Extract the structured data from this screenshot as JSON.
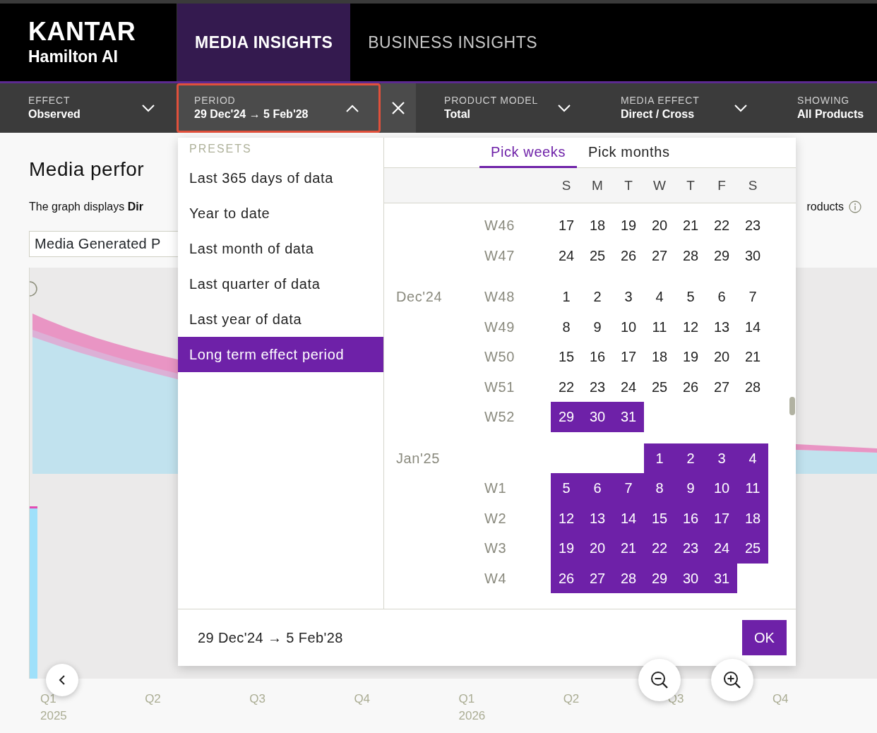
{
  "header": {
    "logo": {
      "brand": "KANTAR",
      "product": "Hamilton AI"
    },
    "tabs": [
      {
        "label": "MEDIA INSIGHTS",
        "selected": true
      },
      {
        "label": "BUSINESS INSIGHTS",
        "selected": false
      }
    ]
  },
  "filters": [
    {
      "kind": "dropdown",
      "label": "EFFECT",
      "value": "Observed",
      "expanded": false,
      "highlighted": false
    },
    {
      "kind": "dropdown",
      "label": "PERIOD",
      "value": "29 Dec'24 → 5 Feb'28",
      "expanded": true,
      "highlighted": true
    },
    {
      "kind": "clear"
    },
    {
      "kind": "dropdown",
      "label": "PRODUCT MODEL",
      "value": "Total",
      "expanded": false,
      "highlighted": false
    },
    {
      "kind": "dropdown",
      "label": "MEDIA EFFECT",
      "value": "Direct / Cross",
      "expanded": false,
      "highlighted": false
    },
    {
      "kind": "text",
      "label": "SHOWING",
      "value": "All Products"
    }
  ],
  "content": {
    "title": "Media perfor",
    "description": "The graph displays **Dir**",
    "description_end": "roducts",
    "metric_select": "Media Generated P",
    "x_axis": [
      {
        "quarter": "Q1",
        "year": "2025"
      },
      {
        "quarter": "Q2"
      },
      {
        "quarter": "Q3"
      },
      {
        "quarter": "Q4"
      },
      {
        "quarter": "Q1",
        "year": "2026"
      },
      {
        "quarter": "Q2"
      },
      {
        "quarter": "Q3"
      },
      {
        "quarter": "Q4"
      }
    ]
  },
  "period_panel": {
    "presets_heading": "PRESETS",
    "presets": [
      {
        "label": "Last 365 days of data",
        "selected": false
      },
      {
        "label": "Year to date",
        "selected": false
      },
      {
        "label": "Last month of data",
        "selected": false
      },
      {
        "label": "Last quarter of data",
        "selected": false
      },
      {
        "label": "Last year of data",
        "selected": false
      },
      {
        "label": "Long term effect period",
        "selected": true
      }
    ],
    "modes": [
      {
        "label": "Pick weeks",
        "selected": true
      },
      {
        "label": "Pick months",
        "selected": false
      }
    ],
    "weekdays": [
      "S",
      "M",
      "T",
      "W",
      "T",
      "F",
      "S"
    ],
    "months": [
      {
        "weeks": [
          {
            "week": "W46",
            "days": [
              {
                "day": "17",
                "selected": false
              },
              {
                "day": "18",
                "selected": false
              },
              {
                "day": "19",
                "selected": false
              },
              {
                "day": "20",
                "selected": false
              },
              {
                "day": "21",
                "selected": false
              },
              {
                "day": "22",
                "selected": false
              },
              {
                "day": "23",
                "selected": false
              }
            ]
          },
          {
            "week": "W47",
            "days": [
              {
                "day": "24",
                "selected": false
              },
              {
                "day": "25",
                "selected": false
              },
              {
                "day": "26",
                "selected": false
              },
              {
                "day": "27",
                "selected": false
              },
              {
                "day": "28",
                "selected": false
              },
              {
                "day": "29",
                "selected": false
              },
              {
                "day": "30",
                "selected": false
              }
            ]
          }
        ]
      },
      {
        "label": "Dec'24",
        "weeks": [
          {
            "week": "W48",
            "days": [
              {
                "day": "1",
                "selected": false
              },
              {
                "day": "2",
                "selected": false
              },
              {
                "day": "3",
                "selected": false
              },
              {
                "day": "4",
                "selected": false
              },
              {
                "day": "5",
                "selected": false
              },
              {
                "day": "6",
                "selected": false
              },
              {
                "day": "7",
                "selected": false
              }
            ]
          },
          {
            "week": "W49",
            "days": [
              {
                "day": "8",
                "selected": false
              },
              {
                "day": "9",
                "selected": false
              },
              {
                "day": "10",
                "selected": false
              },
              {
                "day": "11",
                "selected": false
              },
              {
                "day": "12",
                "selected": false
              },
              {
                "day": "13",
                "selected": false
              },
              {
                "day": "14",
                "selected": false
              }
            ]
          },
          {
            "week": "W50",
            "days": [
              {
                "day": "15",
                "selected": false
              },
              {
                "day": "16",
                "selected": false
              },
              {
                "day": "17",
                "selected": false
              },
              {
                "day": "18",
                "selected": false
              },
              {
                "day": "19",
                "selected": false
              },
              {
                "day": "20",
                "selected": false
              },
              {
                "day": "21",
                "selected": false
              }
            ]
          },
          {
            "week": "W51",
            "days": [
              {
                "day": "22",
                "selected": false
              },
              {
                "day": "23",
                "selected": false
              },
              {
                "day": "24",
                "selected": false
              },
              {
                "day": "25",
                "selected": false
              },
              {
                "day": "26",
                "selected": false
              },
              {
                "day": "27",
                "selected": false
              },
              {
                "day": "28",
                "selected": false
              }
            ]
          },
          {
            "week": "W52",
            "days": [
              {
                "day": "29",
                "selected": true
              },
              {
                "day": "30",
                "selected": true
              },
              {
                "day": "31",
                "selected": true
              }
            ]
          }
        ]
      },
      {
        "label": "Jan'25",
        "weeks": [
          {
            "kind": "partial",
            "days": [
              {
                "day": "1",
                "selected": true
              },
              {
                "day": "2",
                "selected": true
              },
              {
                "day": "3",
                "selected": true
              },
              {
                "day": "4",
                "selected": true
              }
            ]
          },
          {
            "week": "W1",
            "days": [
              {
                "day": "5",
                "selected": true
              },
              {
                "day": "6",
                "selected": true
              },
              {
                "day": "7",
                "selected": true
              },
              {
                "day": "8",
                "selected": true
              },
              {
                "day": "9",
                "selected": true
              },
              {
                "day": "10",
                "selected": true
              },
              {
                "day": "11",
                "selected": true
              }
            ]
          },
          {
            "week": "W2",
            "days": [
              {
                "day": "12",
                "selected": true
              },
              {
                "day": "13",
                "selected": true
              },
              {
                "day": "14",
                "selected": true
              },
              {
                "day": "15",
                "selected": true
              },
              {
                "day": "16",
                "selected": true
              },
              {
                "day": "17",
                "selected": true
              },
              {
                "day": "18",
                "selected": true
              }
            ]
          },
          {
            "week": "W3",
            "days": [
              {
                "day": "19",
                "selected": true
              },
              {
                "day": "20",
                "selected": true
              },
              {
                "day": "21",
                "selected": true
              },
              {
                "day": "22",
                "selected": true
              },
              {
                "day": "23",
                "selected": true
              },
              {
                "day": "24",
                "selected": true
              },
              {
                "day": "25",
                "selected": true
              }
            ]
          },
          {
            "week": "W4",
            "days": [
              {
                "day": "26",
                "selected": true
              },
              {
                "day": "27",
                "selected": true
              },
              {
                "day": "28",
                "selected": true
              },
              {
                "day": "29",
                "selected": true
              },
              {
                "day": "30",
                "selected": true
              },
              {
                "day": "31",
                "selected": true
              }
            ]
          }
        ]
      }
    ],
    "range": "29 Dec'24 → 5 Feb'28",
    "ok": "OK"
  }
}
